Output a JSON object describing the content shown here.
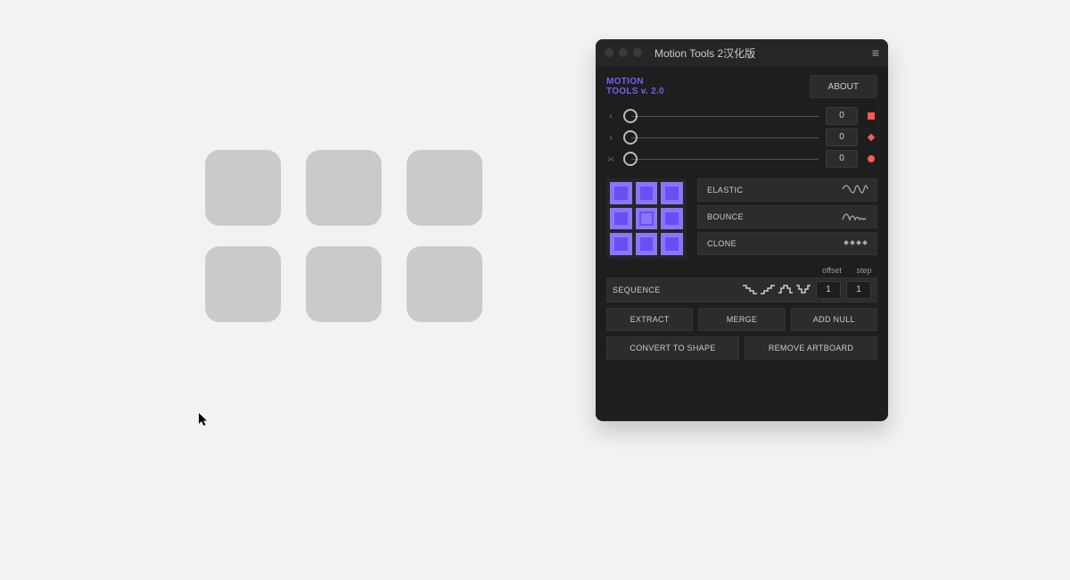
{
  "window": {
    "title": "Motion Tools 2汉化版"
  },
  "brand": {
    "line1": "MOTION",
    "line2": "TOOLS v. 2.0"
  },
  "about": {
    "label": "ABOUT"
  },
  "sliders": [
    {
      "arrow": "‹",
      "value": "0",
      "shape": "square",
      "color": "#ff5a4d"
    },
    {
      "arrow": "›",
      "value": "0",
      "shape": "diamond",
      "color": "#ff5a4d"
    },
    {
      "arrow": "›‹",
      "value": "0",
      "shape": "circle",
      "color": "#ff5a4d"
    }
  ],
  "ease": {
    "elastic": "ELASTIC",
    "bounce": "BOUNCE",
    "clone": "CLONE"
  },
  "sequence": {
    "label": "SEQUENCE",
    "offset_label": "offset",
    "step_label": "step",
    "offset": "1",
    "step": "1"
  },
  "buttons": {
    "extract": "EXTRACT",
    "merge": "MERGE",
    "addnull": "ADD NULL",
    "convert": "CONVERT TO SHAPE",
    "remove": "REMOVE ARTBOARD"
  }
}
